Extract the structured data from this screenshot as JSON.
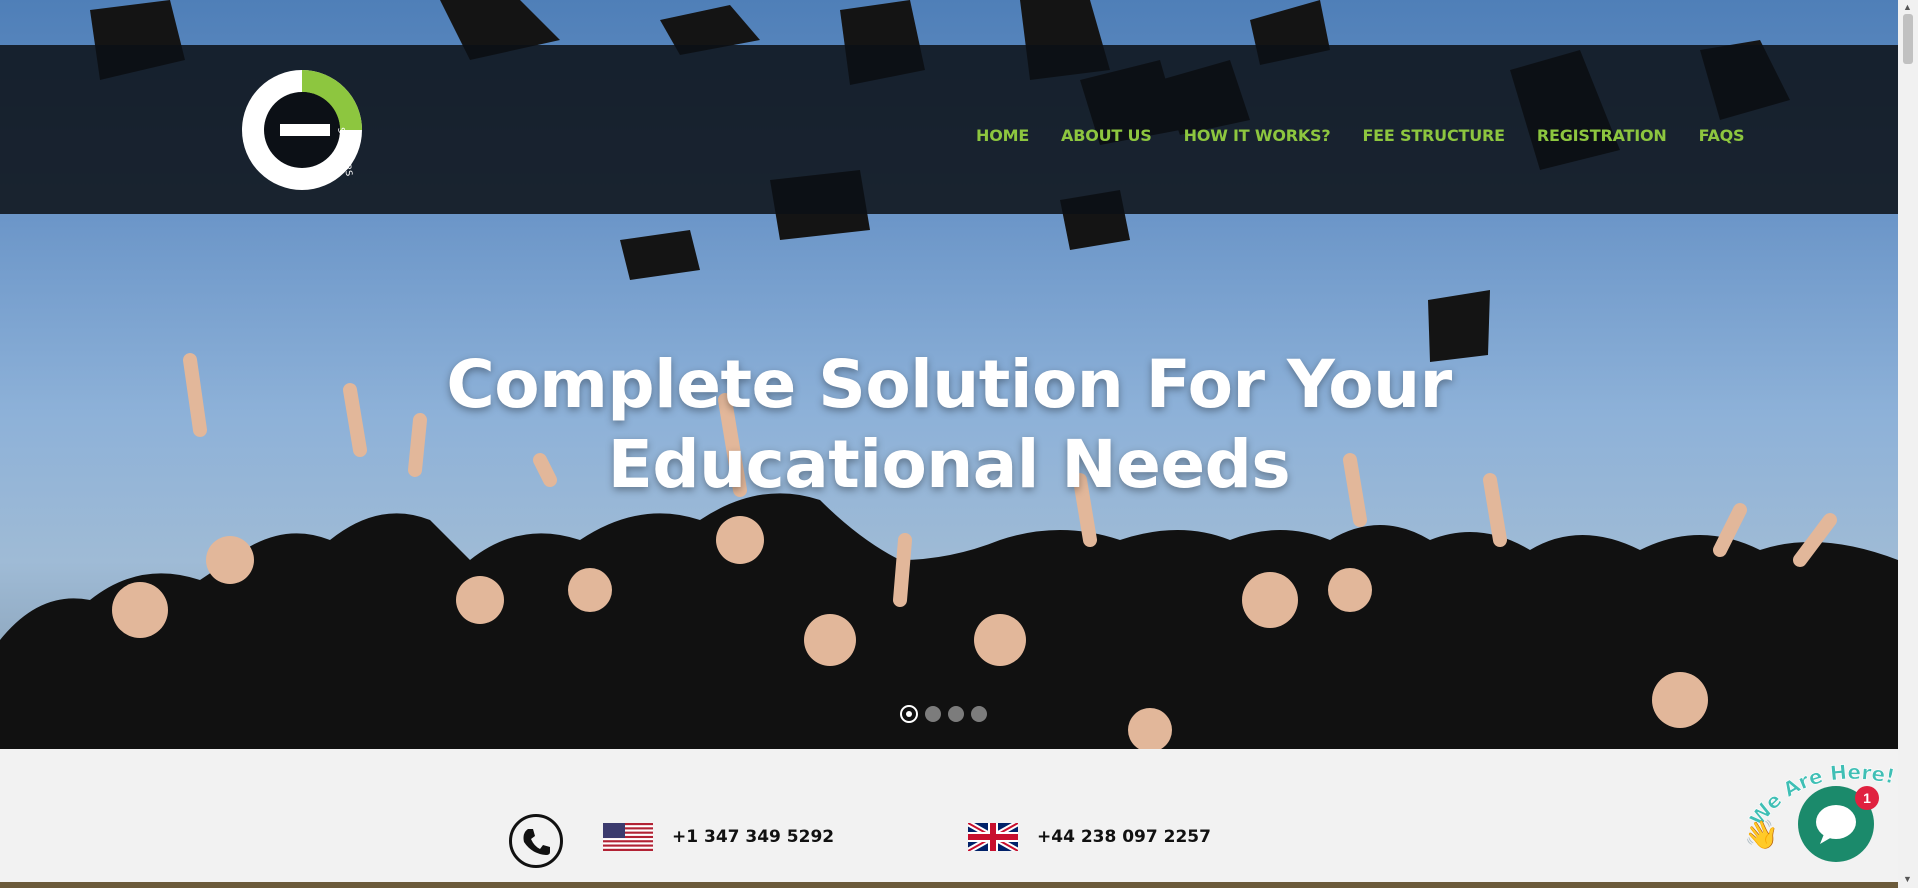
{
  "nav": {
    "items": [
      "HOME",
      "ABOUT US",
      "HOW IT WORKS?",
      "FEE STRUCTURE",
      "REGISTRATION",
      "FAQS"
    ]
  },
  "logo": {
    "text": "SCHOLARS",
    "icon": "e-scholars-logo"
  },
  "hero": {
    "line1": "Complete Solution For Your",
    "line2": "Educational Needs",
    "slides_total": 4,
    "active_slide": 1
  },
  "contact": {
    "us_phone": "+1 347 349 5292",
    "uk_phone": "+44 238 097 2257"
  },
  "chat": {
    "badge": "1",
    "label": "We Are Here!"
  },
  "colors": {
    "accent": "#8dc63f",
    "topbar": "#0c1016",
    "chat": "#1b8a6b",
    "badge": "#e0213f"
  }
}
